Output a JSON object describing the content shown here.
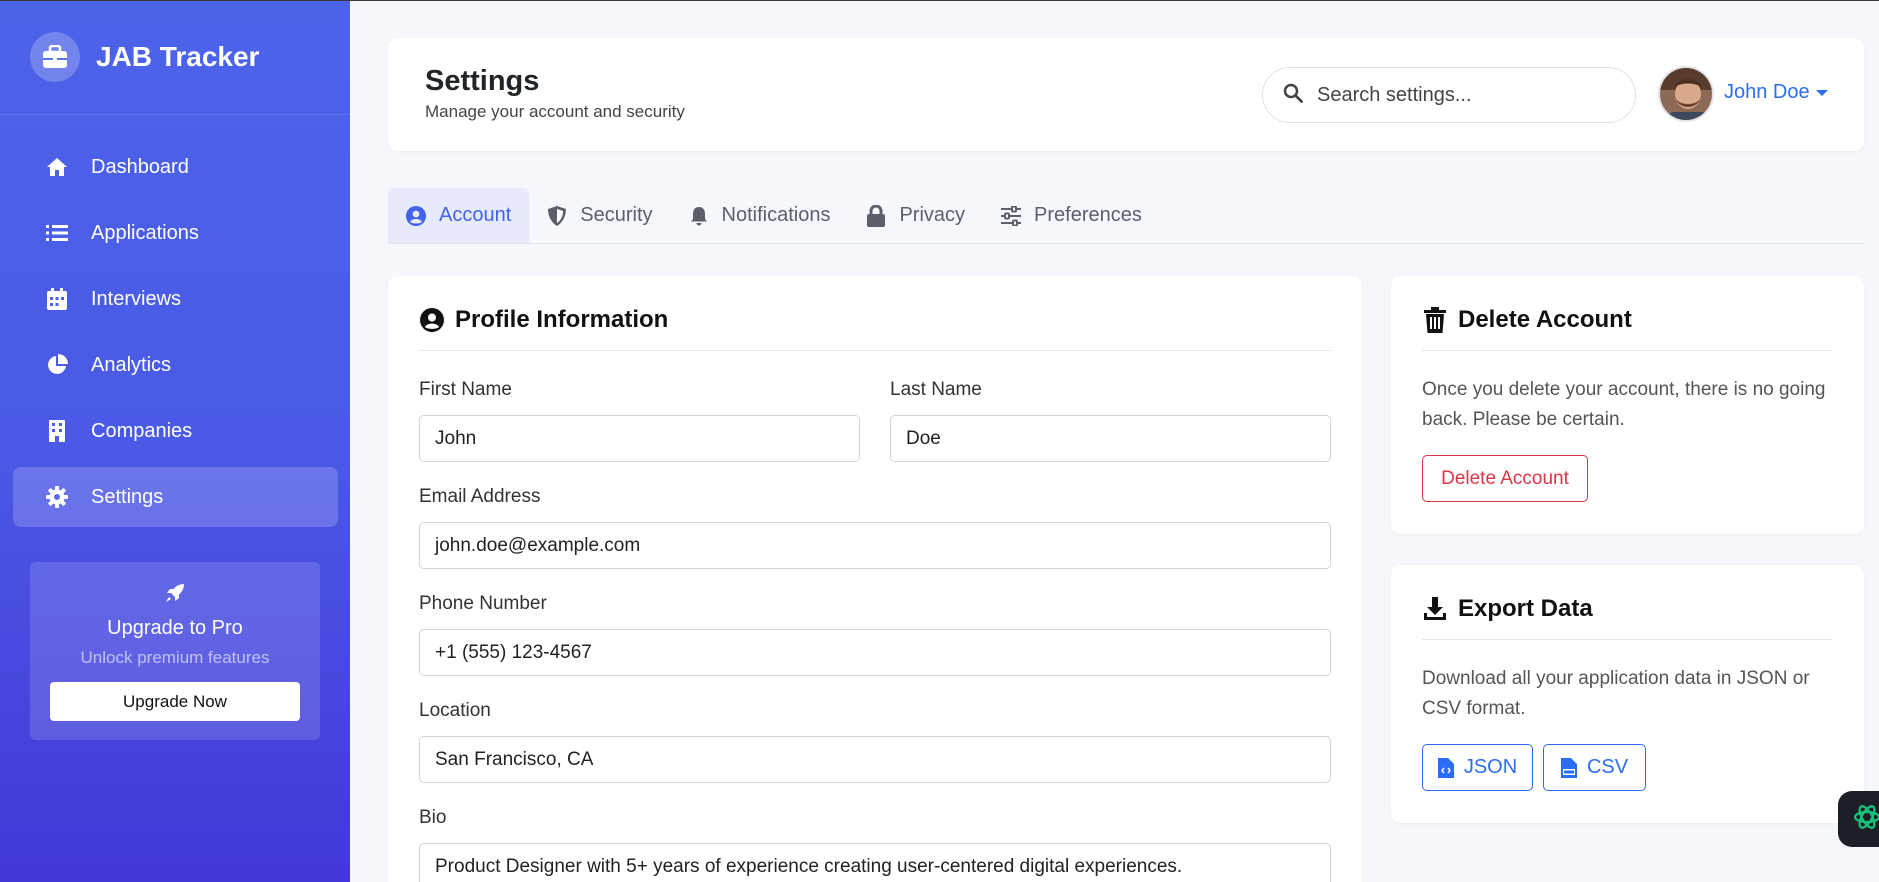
{
  "app": {
    "name": "JAB Tracker",
    "logo_icon": "briefcase-icon"
  },
  "sidebar": {
    "items": [
      {
        "label": "Dashboard",
        "icon": "home-icon",
        "active": false
      },
      {
        "label": "Applications",
        "icon": "list-icon",
        "active": false
      },
      {
        "label": "Interviews",
        "icon": "calendar-icon",
        "active": false
      },
      {
        "label": "Analytics",
        "icon": "pie-chart-icon",
        "active": false
      },
      {
        "label": "Companies",
        "icon": "building-icon",
        "active": false
      },
      {
        "label": "Settings",
        "icon": "gear-icon",
        "active": true
      }
    ],
    "upgrade": {
      "icon": "rocket-icon",
      "title": "Upgrade to Pro",
      "subtitle": "Unlock premium features",
      "button_label": "Upgrade Now"
    }
  },
  "header": {
    "title": "Settings",
    "subtitle": "Manage your account and security",
    "search_placeholder": "Search settings...",
    "user_name": "John Doe"
  },
  "tabs": [
    {
      "label": "Account",
      "icon": "user-circle-icon",
      "active": true
    },
    {
      "label": "Security",
      "icon": "shield-icon",
      "active": false
    },
    {
      "label": "Notifications",
      "icon": "bell-icon",
      "active": false
    },
    {
      "label": "Privacy",
      "icon": "lock-icon",
      "active": false
    },
    {
      "label": "Preferences",
      "icon": "sliders-icon",
      "active": false
    }
  ],
  "profile": {
    "title": "Profile Information",
    "first_name_label": "First Name",
    "first_name": "John",
    "last_name_label": "Last Name",
    "last_name": "Doe",
    "email_label": "Email Address",
    "email": "john.doe@example.com",
    "phone_label": "Phone Number",
    "phone": "+1 (555) 123-4567",
    "location_label": "Location",
    "location": "San Francisco, CA",
    "bio_label": "Bio",
    "bio": "Product Designer with 5+ years of experience creating user-centered digital experiences."
  },
  "delete_account": {
    "title": "Delete Account",
    "text": "Once you delete your account, there is no going back. Please be certain.",
    "button_label": "Delete Account"
  },
  "export": {
    "title": "Export Data",
    "text": "Download all your application data in JSON or CSV format.",
    "json_label": "JSON",
    "csv_label": "CSV"
  },
  "colors": {
    "sidebar_top": "#4c63e8",
    "sidebar_bottom": "#4437d8",
    "accent": "#2a6df4",
    "active_tab": "#4262e8",
    "danger": "#dc3545"
  }
}
